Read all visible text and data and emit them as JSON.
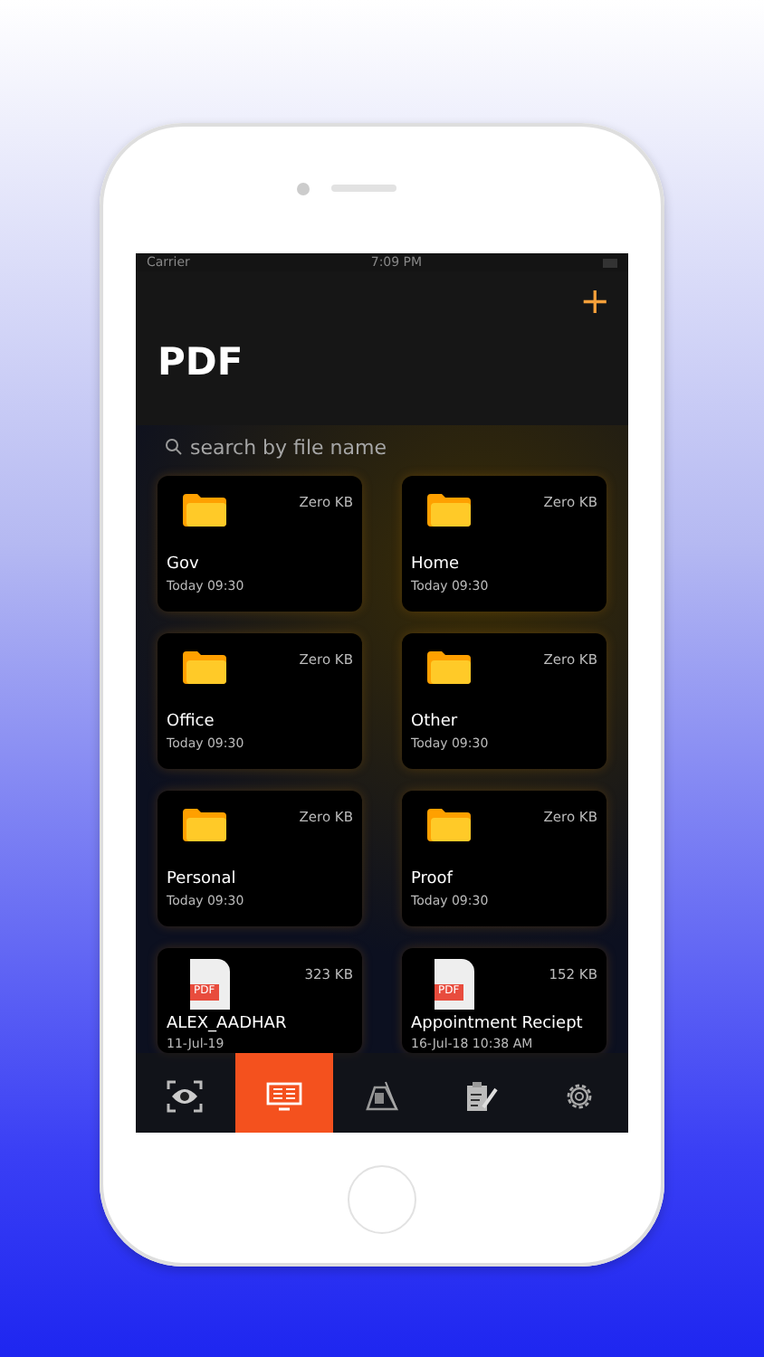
{
  "status_bar": {
    "carrier": "Carrier",
    "time": "7:09 PM"
  },
  "header": {
    "add": "+",
    "title": "PDF"
  },
  "search": {
    "placeholder": "search by file name"
  },
  "files": [
    {
      "kind": "folder",
      "name": "Gov",
      "size": "Zero KB",
      "date": "Today 09:30"
    },
    {
      "kind": "folder",
      "name": "Home",
      "size": "Zero KB",
      "date": "Today 09:30"
    },
    {
      "kind": "folder",
      "name": "Office",
      "size": "Zero KB",
      "date": "Today 09:30"
    },
    {
      "kind": "folder",
      "name": "Other",
      "size": "Zero KB",
      "date": "Today 09:30"
    },
    {
      "kind": "folder",
      "name": "Personal",
      "size": "Zero KB",
      "date": "Today 09:30"
    },
    {
      "kind": "folder",
      "name": "Proof",
      "size": "Zero KB",
      "date": "Today 09:30"
    },
    {
      "kind": "pdf",
      "name": "ALEX_AADHAR",
      "size": "323 KB",
      "date": "11-Jul-19",
      "badge": "PDF"
    },
    {
      "kind": "pdf",
      "name": "Appointment Reciept",
      "size": "152 KB",
      "date": "16-Jul-18 10:38 AM",
      "badge": "PDF"
    }
  ],
  "tabs": [
    {
      "kind": "eye",
      "selected": false
    },
    {
      "kind": "reader",
      "selected": true
    },
    {
      "kind": "scan",
      "selected": false
    },
    {
      "kind": "edit",
      "selected": false
    },
    {
      "kind": "settings",
      "selected": false
    }
  ]
}
